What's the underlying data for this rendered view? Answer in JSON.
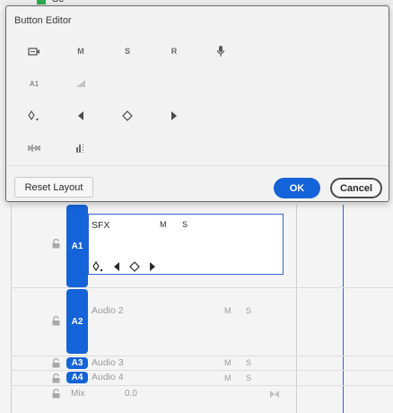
{
  "background": {
    "top_text": "Se",
    "tracks": [
      {
        "badge": "A1",
        "name": "SFX",
        "m": "M",
        "s": "S"
      },
      {
        "badge": "A2",
        "name": "Audio 2",
        "m": "M",
        "s": "S"
      },
      {
        "badge": "A3",
        "name": "Audio 3",
        "m": "M",
        "s": "S"
      },
      {
        "badge": "A4",
        "name": "Audio 4",
        "m": "M",
        "s": "S"
      }
    ],
    "mix": {
      "label": "Mix",
      "value": "0.0"
    }
  },
  "dialog": {
    "title": "Button Editor",
    "row1": {
      "m": "M",
      "s": "S",
      "r": "R"
    },
    "row2": {
      "a1": "A1"
    },
    "reset_label": "Reset Layout",
    "ok_label": "OK",
    "cancel_label": "Cancel"
  },
  "colors": {
    "accent": "#1563d8",
    "badge_bg": "#1563d8",
    "green": "#2fa84f"
  }
}
